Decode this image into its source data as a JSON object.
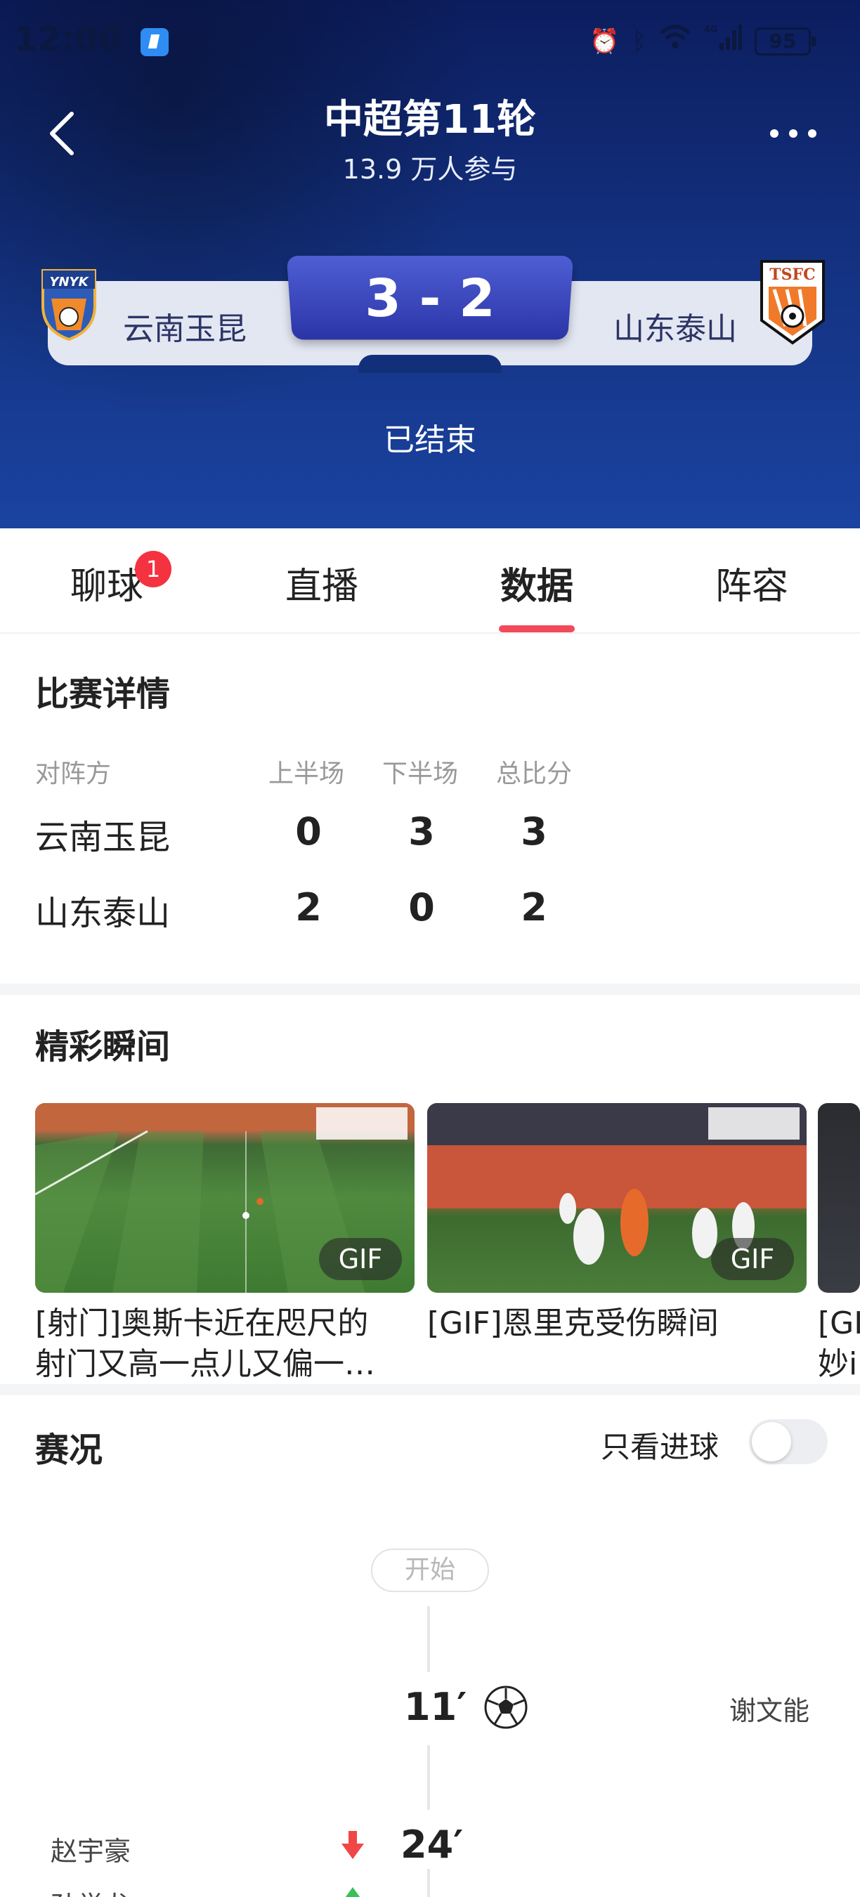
{
  "status_bar": {
    "time": "12:00",
    "battery": "95",
    "icons": [
      "alarm-icon",
      "bluetooth-icon",
      "wifi-icon",
      "4g-signal-icon",
      "battery-icon"
    ]
  },
  "header": {
    "title": "中超第11轮",
    "participants": "13.9 万人参与",
    "home_team": "云南玉昆",
    "away_team": "山东泰山",
    "score": "3 - 2",
    "status": "已结束",
    "home_logo_text": "YNYK",
    "away_logo_text": "TSFC"
  },
  "tabs": [
    {
      "label": "聊球",
      "badge": "1"
    },
    {
      "label": "直播"
    },
    {
      "label": "数据",
      "active": true
    },
    {
      "label": "阵容"
    }
  ],
  "details": {
    "title": "比赛详情",
    "headers": [
      "对阵方",
      "上半场",
      "下半场",
      "总比分"
    ],
    "rows": [
      {
        "team": "云南玉昆",
        "first_half": "0",
        "second_half": "3",
        "total": "3"
      },
      {
        "team": "山东泰山",
        "first_half": "2",
        "second_half": "0",
        "total": "2"
      }
    ]
  },
  "highlights": {
    "title": "精彩瞬间",
    "items": [
      {
        "caption_line1": "[射门]奥斯卡近在咫尺的",
        "caption_line2": "射门又高一点儿又偏一…",
        "tag": "GIF"
      },
      {
        "caption_line1": "[GIF]恩里克受伤瞬间",
        "caption_line2": "",
        "tag": "GIF"
      },
      {
        "caption_line1": "[GI",
        "caption_line2": "妙i",
        "tag": ""
      }
    ]
  },
  "events": {
    "title": "赛况",
    "goals_only_label": "只看进球",
    "goals_only": false,
    "start_label": "开始",
    "items": [
      {
        "minute": "11′",
        "side": "away",
        "player": "谢文能",
        "type": "goal"
      },
      {
        "minute": "24′",
        "side": "home",
        "player": "赵宇豪",
        "type": "sub-out"
      },
      {
        "minute": "",
        "side": "home",
        "player": "孙学龙",
        "type": "sub-in"
      }
    ]
  },
  "colors": {
    "accent": "#f24a5a",
    "score_box": "#3a45bd",
    "header_bg": "#13307e"
  }
}
